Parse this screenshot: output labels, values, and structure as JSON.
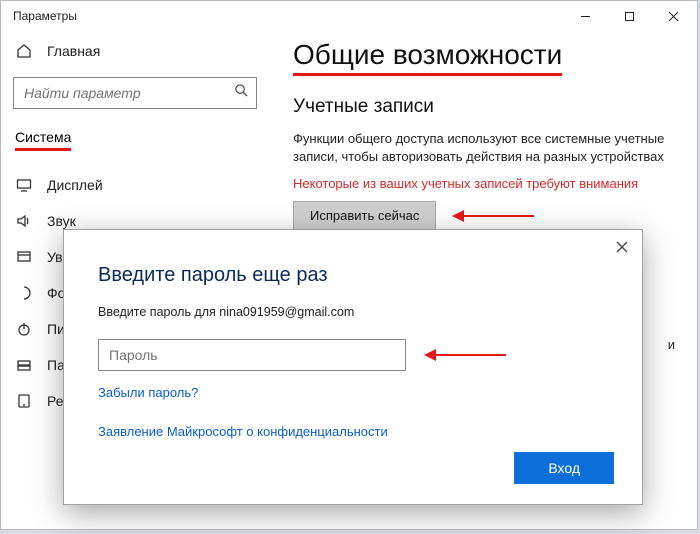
{
  "titlebar": {
    "title": "Параметры"
  },
  "sidebar": {
    "home_label": "Главная",
    "search_placeholder": "Найти параметр",
    "category_label": "Система",
    "items": [
      {
        "label": "Дисплей",
        "icon": "display-icon"
      },
      {
        "label": "Звук",
        "icon": "sound-icon"
      },
      {
        "label": "Уве",
        "icon": "notifications-icon"
      },
      {
        "label": "Фо",
        "icon": "focus-icon"
      },
      {
        "label": "Пит",
        "icon": "power-icon"
      },
      {
        "label": "Пам",
        "icon": "storage-icon"
      },
      {
        "label": "Реж",
        "icon": "tablet-icon"
      }
    ]
  },
  "main": {
    "page_title": "Общие возможности",
    "section_title": "Учетные записи",
    "section_desc": "Функции общего доступа используют все системные учетные записи, чтобы авторизовать действия на разных устройствах",
    "warning": "Некоторые из ваших учетных записей требуют внимания",
    "fix_label": "Исправить сейчас",
    "stray_char": "и"
  },
  "dialog": {
    "title": "Введите пароль еще раз",
    "subtitle": "Введите пароль для nina091959@gmail.com",
    "password_placeholder": "Пароль",
    "forgot_link": "Забыли пароль?",
    "privacy_link": "Заявление Майкрософт о конфиденциальности",
    "submit_label": "Вход"
  }
}
